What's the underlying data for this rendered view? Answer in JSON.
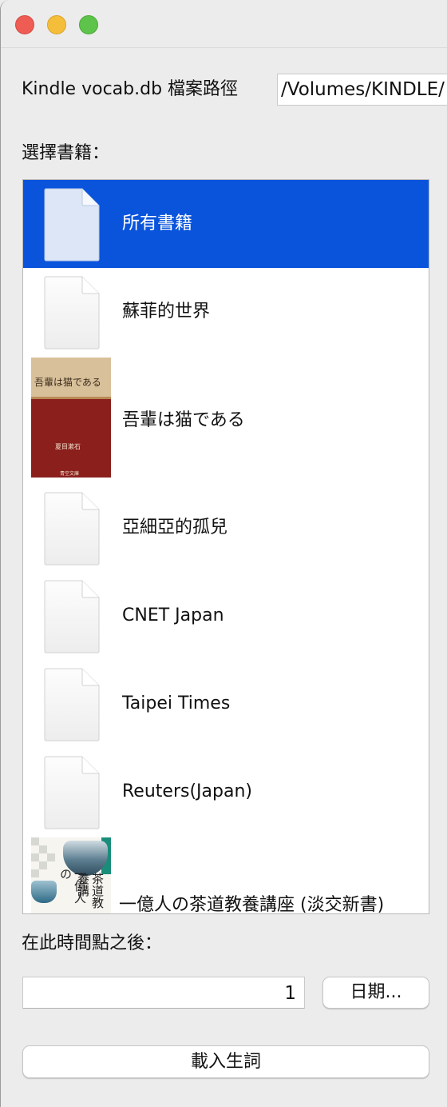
{
  "window": {
    "title": ""
  },
  "path": {
    "label": "Kindle vocab.db 檔案路徑",
    "value": "/Volumes/KINDLE/"
  },
  "select_books": {
    "label": "選擇書籍："
  },
  "books": [
    {
      "title": "所有書籍",
      "icon": "document-icon",
      "selected": true
    },
    {
      "title": "蘇菲的世界",
      "icon": "document-icon",
      "selected": false
    },
    {
      "title": "吾輩は猫である",
      "icon": "book-cover",
      "selected": false,
      "cover": {
        "title": "吾輩は猫である",
        "author": "夏目漱石",
        "publisher": "青空文庫"
      }
    },
    {
      "title": "亞細亞的孤兒",
      "icon": "document-icon",
      "selected": false
    },
    {
      "title": "CNET Japan",
      "icon": "document-icon",
      "selected": false
    },
    {
      "title": "Taipei Times",
      "icon": "document-icon",
      "selected": false
    },
    {
      "title": "Reuters(Japan)",
      "icon": "document-icon",
      "selected": false
    },
    {
      "title": "一億人の茶道教養講座 (淡交新書)",
      "icon": "book-cover",
      "selected": false,
      "cover": {
        "line1": "一億人の",
        "line2": "茶道教養講"
      }
    }
  ],
  "after": {
    "label": "在此時間點之後：",
    "value": "1",
    "date_button": "日期..."
  },
  "load_button": "載入生詞",
  "colors": {
    "selection": "#0a54dc",
    "close": "#ee5c54",
    "minimize": "#f5be3a",
    "maximize": "#5ec34a"
  }
}
